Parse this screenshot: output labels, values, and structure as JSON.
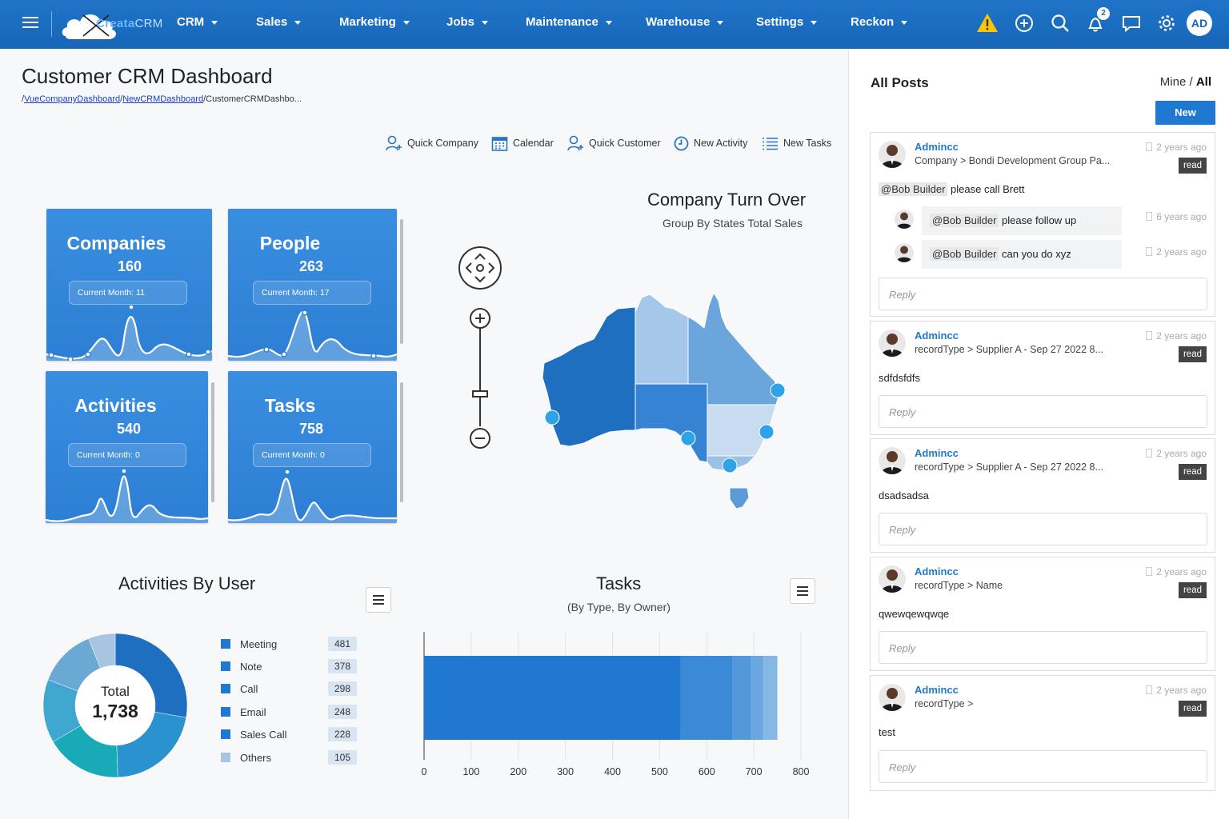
{
  "brand": {
    "logo_text": "Creata",
    "logo_suffix": "CRM"
  },
  "nav": [
    {
      "label": "CRM"
    },
    {
      "label": "Sales"
    },
    {
      "label": "Marketing"
    },
    {
      "label": "Jobs"
    },
    {
      "label": "Maintenance"
    },
    {
      "label": "Warehouse"
    },
    {
      "label": "Settings"
    },
    {
      "label": "Reckon"
    }
  ],
  "topbar": {
    "notification_count": "2",
    "user_initials": "AD",
    "icons": [
      "warning-icon",
      "add-circle-icon",
      "search-icon",
      "bell-icon",
      "chat-icon",
      "gear-icon"
    ]
  },
  "page": {
    "title": "Customer CRM Dashboard",
    "breadcrumb": {
      "sep": "/",
      "part1": "VueCompanyDashboard",
      "part2": "NewCRMDashboard",
      "part3": "CustomerCRMDashbo..."
    }
  },
  "quick_actions": [
    {
      "label": "Quick Company",
      "icon": "add-user-icon"
    },
    {
      "label": "Calendar",
      "icon": "calendar-icon"
    },
    {
      "label": "Quick Customer",
      "icon": "add-user-icon"
    },
    {
      "label": "New Activity",
      "icon": "clock-icon"
    },
    {
      "label": "New Tasks",
      "icon": "list-icon"
    }
  ],
  "tiles": [
    {
      "title": "Companies",
      "count": "160",
      "month": "Current Month: 11"
    },
    {
      "title": "People",
      "count": "263",
      "month": "Current Month: 17"
    },
    {
      "title": "Activities",
      "count": "540",
      "month": "Current Month: 0"
    },
    {
      "title": "Tasks",
      "count": "758",
      "month": "Current Month: 0"
    }
  ],
  "map_card": {
    "title": "Company Turn Over",
    "subtitle": "Group By States Total Sales"
  },
  "activities_card": {
    "title": "Activities By User",
    "total_label": "Total",
    "total_value": "1,738"
  },
  "tasks_card": {
    "title": "Tasks",
    "subtitle": "(By Type, By Owner)"
  },
  "colors": {
    "primary": "#1f78d1",
    "topbar": "#1766b7",
    "tile": "#2f84d8"
  },
  "chart_data": [
    {
      "type": "pie",
      "title": "Activities By User",
      "total": 1738,
      "categories": [
        "Meeting",
        "Note",
        "Call",
        "Email",
        "Sales Call",
        "Others"
      ],
      "values": [
        481,
        378,
        298,
        248,
        228,
        105
      ],
      "colors": [
        "#1e6fc0",
        "#2a93cf",
        "#19aab8",
        "#3fa7d0",
        "#6aa9d4",
        "#a7c4e0"
      ]
    },
    {
      "type": "bar",
      "title": "Tasks",
      "subtitle": "(By Type, By Owner)",
      "orientation": "horizontal",
      "stacked": true,
      "xlim": [
        0,
        800
      ],
      "xticks": [
        0,
        100,
        200,
        300,
        400,
        500,
        600,
        700,
        800
      ],
      "series": [
        {
          "values": [
            545
          ],
          "color": "#2178d0"
        },
        {
          "values": [
            110
          ],
          "color": "#3a8ad8"
        },
        {
          "values": [
            38
          ],
          "color": "#5498dc"
        },
        {
          "values": [
            27
          ],
          "color": "#6aa6e0"
        },
        {
          "values": [
            30
          ],
          "color": "#86b8e6"
        }
      ],
      "total": 750
    }
  ],
  "posts_panel": {
    "title": "All Posts",
    "filter_mine": "Mine",
    "filter_sep": "/",
    "filter_all": "All",
    "new_label": "New",
    "reply_placeholder": "Reply"
  },
  "posts": [
    {
      "author": "Admincc",
      "context": "Company > Bondi Development Group Pa...",
      "time": "2 years ago",
      "read": "read",
      "mention": "@Bob Builder",
      "text": "please call Brett",
      "comments": [
        {
          "mention": "@Bob Builder",
          "text": "please follow up",
          "time": "6 years ago"
        },
        {
          "mention": "@Bob Builder",
          "text": "can you do xyz",
          "time": "2 years ago"
        }
      ]
    },
    {
      "author": "Admincc",
      "context": "recordType > Supplier A - Sep 27 2022 8...",
      "time": "2 years ago",
      "read": "read",
      "text": "sdfdsfdfs"
    },
    {
      "author": "Admincc",
      "context": "recordType > Supplier A - Sep 27 2022 8...",
      "time": "2 years ago",
      "read": "read",
      "text": "dsadsadsa"
    },
    {
      "author": "Admincc",
      "context": "recordType > Name",
      "time": "2 years ago",
      "read": "read",
      "text": "qwewqewqwqe"
    },
    {
      "author": "Admincc",
      "context": "recordType >",
      "time": "2 years ago",
      "read": "read",
      "text": "test"
    }
  ]
}
